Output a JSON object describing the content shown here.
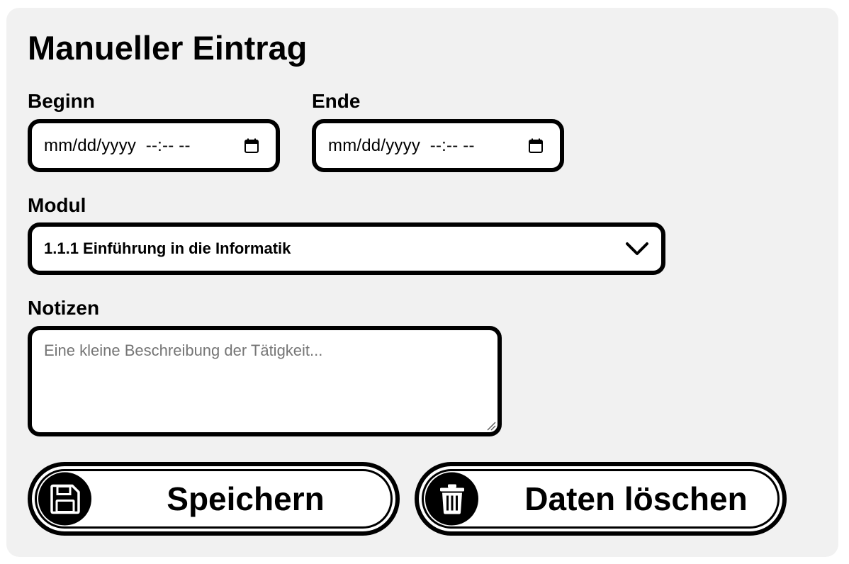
{
  "form": {
    "title": "Manueller Eintrag",
    "begin": {
      "label": "Beginn",
      "value": "mm/dd/yyyy  --:-- --",
      "icon": "calendar-icon"
    },
    "end": {
      "label": "Ende",
      "value": "mm/dd/yyyy  --:-- --",
      "icon": "calendar-icon"
    },
    "module": {
      "label": "Modul",
      "selected": "1.1.1 Einführung in die Informatik",
      "icon": "chevron-down-icon"
    },
    "notes": {
      "label": "Notizen",
      "placeholder": "Eine kleine Beschreibung der Tätigkeit..."
    }
  },
  "buttons": {
    "save": {
      "label": "Speichern",
      "icon": "floppy-disk-icon"
    },
    "delete": {
      "label": "Daten löschen",
      "icon": "trash-icon"
    }
  },
  "colors": {
    "card_background": "#f1f1f1",
    "border": "#000000",
    "placeholder": "#757575"
  }
}
